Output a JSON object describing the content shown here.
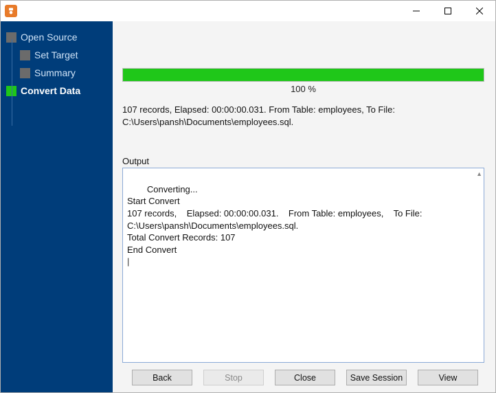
{
  "window": {
    "title": ""
  },
  "titlebar": {
    "minimize": "—",
    "maximize": "□",
    "close": "×"
  },
  "sidebar": {
    "steps": [
      {
        "label": "Open Source"
      },
      {
        "label": "Set Target"
      },
      {
        "label": "Summary"
      },
      {
        "label": "Convert Data"
      }
    ]
  },
  "progress": {
    "percent": 100,
    "label": "100 %"
  },
  "summary": "107 records,    Elapsed: 00:00:00.031.    From Table: employees,    To File: C:\\Users\\pansh\\Documents\\employees.sql.",
  "output": {
    "label": "Output",
    "text": "Converting...\nStart Convert\n107 records,    Elapsed: 00:00:00.031.    From Table: employees,    To File: C:\\Users\\pansh\\Documents\\employees.sql.\nTotal Convert Records: 107\nEnd Convert"
  },
  "buttons": {
    "back": "Back",
    "stop": "Stop",
    "close": "Close",
    "save_session": "Save Session",
    "view": "View"
  }
}
